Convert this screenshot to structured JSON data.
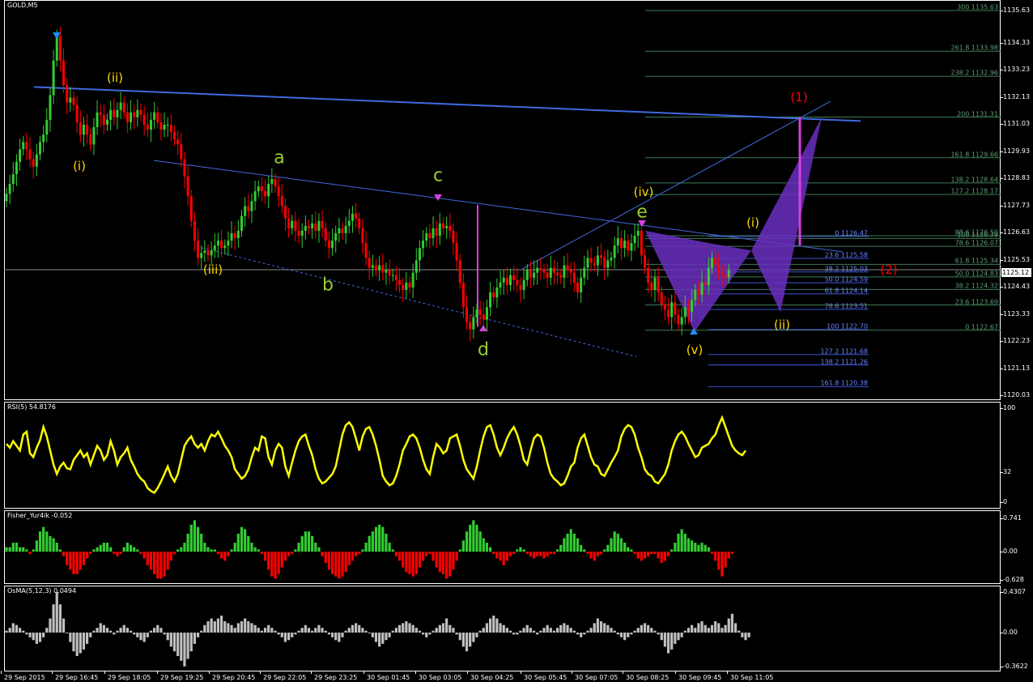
{
  "symbol_title": "GOLD,M5",
  "price_axis": [
    "1135.63",
    "1134.33",
    "1133.23",
    "1132.13",
    "1131.03",
    "1129.93",
    "1128.83",
    "1127.73",
    "1126.63",
    "1125.53",
    "1124.43",
    "1123.33",
    "1122.23",
    "1121.13",
    "1120.03"
  ],
  "current_price": "1125.12",
  "waves": [
    {
      "text": "(ii)",
      "color": "#FFD700"
    },
    {
      "text": "(i)",
      "color": "#FFD700"
    },
    {
      "text": "(iii)",
      "color": "#FFD700"
    },
    {
      "text": "a",
      "color": "#9ACD32"
    },
    {
      "text": "b",
      "color": "#9ACD32"
    },
    {
      "text": "c",
      "color": "#9ACD32"
    },
    {
      "text": "d",
      "color": "#9ACD32"
    },
    {
      "text": "(iv)",
      "color": "#FFD700"
    },
    {
      "text": "e",
      "color": "#9ACD32"
    },
    {
      "text": "(v)",
      "color": "#FFD700"
    },
    {
      "text": "(i)",
      "color": "#FFD700"
    },
    {
      "text": "(ii)",
      "color": "#FFD700"
    },
    {
      "text": "(1)",
      "color": "#FF0000"
    },
    {
      "text": "(2)",
      "color": "#FF0000"
    }
  ],
  "fib_upper": [
    "300 1135.63",
    "261.8 1133.98",
    "238.2 1132.96",
    "200 1131.31",
    "161.8 1129.66",
    "138.2 1128.64",
    "127.2 1128.17",
    "100 1126.39",
    "88.6 1126.50",
    "78.6 1126.07",
    "61.8 1125.34",
    "50.0 1124.83",
    "38.2 1124.32",
    "23.6 1123.69",
    "0 1122.67"
  ],
  "fib_lower": [
    "0 1126.47",
    "23.6 1125.58",
    "38.2 1125.03",
    "50.0 1124.59",
    "61.8 1124.14",
    "78.6 1123.51",
    "100 1122.70",
    "127.2 1121.68",
    "138.2 1121.26",
    "161.8 1120.38"
  ],
  "rsi": {
    "title": "RSI(5) 54.8176",
    "axis": [
      "100",
      "32",
      "0"
    ]
  },
  "fisher": {
    "title": "Fisher_Yur4ik -0.052",
    "axis": [
      "0.741",
      "0.00",
      "-0.628"
    ]
  },
  "osma": {
    "title": "OsMA(5,12,3) 0.0494",
    "axis": [
      "0.4307",
      "0.00",
      "-0.3622"
    ]
  },
  "time_labels": [
    "29 Sep 2015",
    "29 Sep 16:45",
    "29 Sep 18:05",
    "29 Sep 19:25",
    "29 Sep 20:45",
    "29 Sep 22:05",
    "29 Sep 23:25",
    "30 Sep 01:45",
    "30 Sep 03:05",
    "30 Sep 04:25",
    "30 Sep 05:45",
    "30 Sep 07:05",
    "30 Sep 08:25",
    "30 Sep 09:45",
    "30 Sep 11:05"
  ],
  "colors": {
    "bull": "#32CD32",
    "bear": "#FF0000",
    "trend": "#4169E1",
    "pattern": "#6A2FC0",
    "hist_grey": "#C0C0C0",
    "rsi": "#FFFF00"
  },
  "chart_data": {
    "type": "candlestick",
    "closes": [
      1128.2,
      1128.6,
      1129.0,
      1129.5,
      1130.0,
      1130.3,
      1130.0,
      1129.6,
      1129.3,
      1129.8,
      1130.3,
      1130.6,
      1131.2,
      1132.2,
      1133.6,
      1134.6,
      1133.6,
      1132.6,
      1131.9,
      1132.1,
      1131.8,
      1131.1,
      1130.6,
      1131.0,
      1130.6,
      1130.2,
      1130.9,
      1131.5,
      1131.4,
      1131.0,
      1131.2,
      1131.6,
      1131.3,
      1131.6,
      1131.9,
      1131.5,
      1131.1,
      1131.5,
      1131.3,
      1131.6,
      1131.4,
      1131.0,
      1130.8,
      1131.2,
      1131.5,
      1131.1,
      1130.8,
      1131.0,
      1131.0,
      1130.7,
      1130.4,
      1130.2,
      1129.6,
      1128.9,
      1128.1,
      1127.1,
      1126.3,
      1125.6,
      1125.8,
      1125.9,
      1125.7,
      1125.9,
      1126.1,
      1126.3,
      1126.0,
      1126.1,
      1126.3,
      1126.6,
      1126.4,
      1126.7,
      1127.3,
      1127.7,
      1127.5,
      1127.9,
      1128.3,
      1128.5,
      1128.3,
      1128.1,
      1128.6,
      1128.8,
      1128.5,
      1128.1,
      1127.7,
      1127.2,
      1126.8,
      1127.1,
      1126.7,
      1126.5,
      1126.7,
      1126.9,
      1126.8,
      1127.0,
      1126.7,
      1127.1,
      1126.8,
      1126.3,
      1126.0,
      1126.3,
      1126.6,
      1126.8,
      1126.6,
      1126.9,
      1127.1,
      1127.4,
      1127.2,
      1126.8,
      1126.2,
      1125.6,
      1125.2,
      1125.3,
      1125.1,
      1125.3,
      1125.0,
      1125.1,
      1124.9,
      1124.9,
      1124.7,
      1124.5,
      1124.3,
      1124.6,
      1124.4,
      1125.0,
      1125.5,
      1126.0,
      1126.3,
      1126.6,
      1126.4,
      1126.8,
      1126.5,
      1127.0,
      1126.8,
      1126.9,
      1126.7,
      1126.2,
      1125.5,
      1124.6,
      1123.6,
      1123.0,
      1122.7,
      1123.2,
      1123.5,
      1123.3,
      1123.1,
      1123.6,
      1124.2,
      1124.0,
      1124.4,
      1124.6,
      1124.8,
      1124.5,
      1124.9,
      1124.7,
      1124.5,
      1124.3,
      1124.7,
      1125.1,
      1124.8,
      1125.0,
      1125.2,
      1125.1,
      1125.0,
      1124.8,
      1125.2,
      1125.0,
      1124.9,
      1124.8,
      1125.3,
      1125.1,
      1125.0,
      1124.6,
      1124.2,
      1124.8,
      1125.2,
      1125.6,
      1125.4,
      1125.3,
      1125.7,
      1125.6,
      1125.2,
      1125.5,
      1125.6,
      1126.1,
      1126.4,
      1126.0,
      1126.3,
      1125.9,
      1126.2,
      1126.5,
      1126.7,
      1125.7,
      1125.2,
      1124.6,
      1124.3,
      1124.8,
      1124.2,
      1123.7,
      1123.5,
      1123.2,
      1123.8,
      1123.3,
      1122.9,
      1123.2,
      1123.6,
      1123.4,
      1123.9,
      1124.3,
      1124.1,
      1124.6,
      1124.5,
      1125.2,
      1125.6,
      1125.3,
      1125.0,
      1124.9,
      1124.8,
      1125.12
    ],
    "rsi": [
      62,
      58,
      65,
      60,
      55,
      72,
      75,
      52,
      48,
      58,
      66,
      80,
      70,
      55,
      40,
      30,
      38,
      42,
      36,
      35,
      45,
      50,
      55,
      48,
      52,
      40,
      50,
      60,
      55,
      45,
      50,
      65,
      55,
      40,
      48,
      52,
      58,
      45,
      38,
      30,
      25,
      22,
      15,
      12,
      10,
      15,
      22,
      30,
      38,
      28,
      22,
      30,
      45,
      60,
      66,
      70,
      62,
      58,
      62,
      55,
      65,
      72,
      70,
      75,
      68,
      60,
      55,
      48,
      35,
      30,
      25,
      28,
      35,
      48,
      58,
      55,
      70,
      68,
      48,
      40,
      55,
      62,
      58,
      38,
      28,
      42,
      55,
      65,
      70,
      72,
      60,
      50,
      35,
      25,
      20,
      22,
      26,
      30,
      38,
      55,
      72,
      82,
      85,
      80,
      68,
      55,
      70,
      78,
      80,
      72,
      60,
      45,
      28,
      22,
      18,
      20,
      28,
      40,
      55,
      62,
      70,
      72,
      68,
      58,
      45,
      35,
      30,
      48,
      62,
      58,
      52,
      55,
      68,
      70,
      72,
      60,
      45,
      35,
      30,
      25,
      38,
      55,
      70,
      80,
      82,
      72,
      58,
      50,
      58,
      68,
      75,
      80,
      72,
      60,
      45,
      40,
      55,
      68,
      72,
      70,
      58,
      42,
      30,
      25,
      22,
      18,
      20,
      28,
      38,
      42,
      58,
      68,
      72,
      60,
      48,
      40,
      38,
      30,
      28,
      35,
      42,
      48,
      55,
      70,
      78,
      82,
      80,
      72,
      58,
      48,
      35,
      30,
      28,
      22,
      20,
      25,
      30,
      40,
      55,
      65,
      72,
      75,
      70,
      62,
      55,
      48,
      50,
      58,
      60,
      62,
      68,
      72,
      82,
      90,
      80,
      70,
      60,
      55,
      52,
      50,
      55
    ],
    "fisher": [
      0.1,
      0.1,
      0.2,
      0.2,
      0.1,
      0.1,
      0.05,
      -0.05,
      0.05,
      0.25,
      0.45,
      0.55,
      0.45,
      0.35,
      0.3,
      0.2,
      0.05,
      -0.1,
      -0.3,
      -0.4,
      -0.5,
      -0.5,
      -0.4,
      -0.3,
      -0.15,
      -0.05,
      0.05,
      0.1,
      0.15,
      0.2,
      0.2,
      0.1,
      -0.05,
      -0.1,
      -0.05,
      0.1,
      0.2,
      0.15,
      0.1,
      0.05,
      -0.05,
      -0.15,
      -0.3,
      -0.4,
      -0.5,
      -0.6,
      -0.6,
      -0.55,
      -0.4,
      -0.2,
      -0.05,
      0.05,
      0.1,
      0.2,
      0.4,
      0.6,
      0.7,
      0.55,
      0.4,
      0.2,
      0.1,
      0.05,
      0.05,
      -0.05,
      -0.15,
      -0.2,
      -0.1,
      0.05,
      0.2,
      0.4,
      0.55,
      0.5,
      0.35,
      0.2,
      0.1,
      0.05,
      -0.05,
      -0.2,
      -0.4,
      -0.55,
      -0.6,
      -0.5,
      -0.35,
      -0.2,
      -0.1,
      -0.05,
      0.05,
      0.2,
      0.35,
      0.45,
      0.45,
      0.35,
      0.2,
      0.1,
      -0.1,
      -0.25,
      -0.4,
      -0.5,
      -0.55,
      -0.6,
      -0.55,
      -0.45,
      -0.3,
      -0.2,
      -0.1,
      -0.05,
      0.05,
      0.2,
      0.35,
      0.45,
      0.55,
      0.6,
      0.55,
      0.4,
      0.2,
      0.05,
      -0.1,
      -0.2,
      -0.35,
      -0.45,
      -0.5,
      -0.55,
      -0.5,
      -0.35,
      -0.2,
      -0.1,
      -0.05,
      -0.2,
      -0.35,
      -0.45,
      -0.5,
      -0.6,
      -0.55,
      -0.4,
      -0.2,
      0.05,
      0.25,
      0.45,
      0.6,
      0.7,
      0.6,
      0.45,
      0.3,
      0.2,
      0.1,
      -0.05,
      -0.15,
      -0.2,
      -0.3,
      -0.2,
      -0.1,
      -0.05,
      0.05,
      0.1,
      0.05,
      -0.05,
      -0.1,
      -0.15,
      -0.1,
      -0.1,
      -0.15,
      -0.1,
      -0.05,
      -0.05,
      0.05,
      0.15,
      0.3,
      0.4,
      0.5,
      0.4,
      0.3,
      0.15,
      0.05,
      -0.05,
      -0.15,
      -0.2,
      -0.1,
      -0.05,
      0.05,
      0.15,
      0.3,
      0.45,
      0.4,
      0.3,
      0.2,
      0.1,
      0.05,
      -0.05,
      -0.15,
      -0.2,
      -0.15,
      -0.1,
      -0.05,
      -0.05,
      -0.15,
      -0.25,
      -0.2,
      -0.1,
      0.05,
      0.2,
      0.4,
      0.5,
      0.4,
      0.3,
      0.25,
      0.2,
      0.15,
      0.2,
      0.15,
      0.1,
      -0.05,
      -0.2,
      -0.4,
      -0.55,
      -0.35,
      -0.15,
      -0.05
    ],
    "osma": [
      0.02,
      0.05,
      0.1,
      0.08,
      0.05,
      0.02,
      -0.02,
      -0.05,
      -0.08,
      -0.12,
      -0.1,
      -0.05,
      0.05,
      0.15,
      0.3,
      0.43,
      0.3,
      0.15,
      0.0,
      -0.1,
      -0.2,
      -0.25,
      -0.22,
      -0.18,
      -0.12,
      -0.05,
      0.02,
      0.05,
      0.1,
      0.08,
      0.05,
      0.02,
      -0.02,
      0.02,
      0.05,
      0.08,
      0.05,
      0.02,
      -0.02,
      -0.05,
      -0.08,
      -0.1,
      -0.05,
      0.02,
      0.05,
      0.08,
      0.05,
      -0.02,
      -0.08,
      -0.15,
      -0.2,
      -0.25,
      -0.3,
      -0.36,
      -0.28,
      -0.2,
      -0.12,
      -0.05,
      0.02,
      0.08,
      0.12,
      0.15,
      0.12,
      0.15,
      0.18,
      0.12,
      0.1,
      0.08,
      0.05,
      0.1,
      0.12,
      0.15,
      0.12,
      0.1,
      0.08,
      0.05,
      0.02,
      0.05,
      0.08,
      0.05,
      0.02,
      -0.02,
      -0.05,
      -0.1,
      -0.08,
      -0.05,
      -0.02,
      0.02,
      0.05,
      0.08,
      0.05,
      0.02,
      0.05,
      0.08,
      0.05,
      0.02,
      -0.02,
      -0.05,
      -0.08,
      -0.1,
      -0.05,
      0.02,
      0.05,
      0.08,
      0.1,
      0.08,
      0.05,
      0.02,
      0.0,
      -0.05,
      -0.1,
      -0.15,
      -0.12,
      -0.08,
      -0.05,
      0.02,
      0.05,
      0.08,
      0.1,
      0.12,
      0.1,
      0.08,
      0.05,
      0.02,
      -0.02,
      -0.05,
      -0.02,
      0.02,
      0.05,
      0.08,
      0.1,
      0.15,
      0.08,
      0.05,
      -0.02,
      -0.08,
      -0.15,
      -0.2,
      -0.15,
      -0.1,
      -0.05,
      0.02,
      0.05,
      0.1,
      0.15,
      0.18,
      0.15,
      0.1,
      0.08,
      0.05,
      0.02,
      -0.02,
      -0.02,
      0.02,
      0.05,
      0.08,
      0.05,
      0.02,
      -0.02,
      0.02,
      0.05,
      0.08,
      0.05,
      0.02,
      0.05,
      0.08,
      0.1,
      0.08,
      0.05,
      0.02,
      -0.02,
      -0.05,
      -0.02,
      0.02,
      0.05,
      0.1,
      0.15,
      0.12,
      0.1,
      0.08,
      0.05,
      0.02,
      -0.02,
      -0.05,
      -0.08,
      -0.05,
      -0.02,
      0.02,
      0.05,
      0.08,
      0.1,
      0.08,
      0.05,
      0.02,
      -0.02,
      -0.08,
      -0.15,
      -0.22,
      -0.18,
      -0.12,
      -0.08,
      -0.05,
      0.02,
      0.05,
      0.08,
      0.05,
      0.1,
      0.12,
      0.08,
      0.05,
      0.08,
      0.12,
      0.1,
      0.05,
      0.08,
      0.15,
      0.2,
      0.1,
      0.02,
      -0.05,
      -0.08,
      -0.05
    ]
  }
}
